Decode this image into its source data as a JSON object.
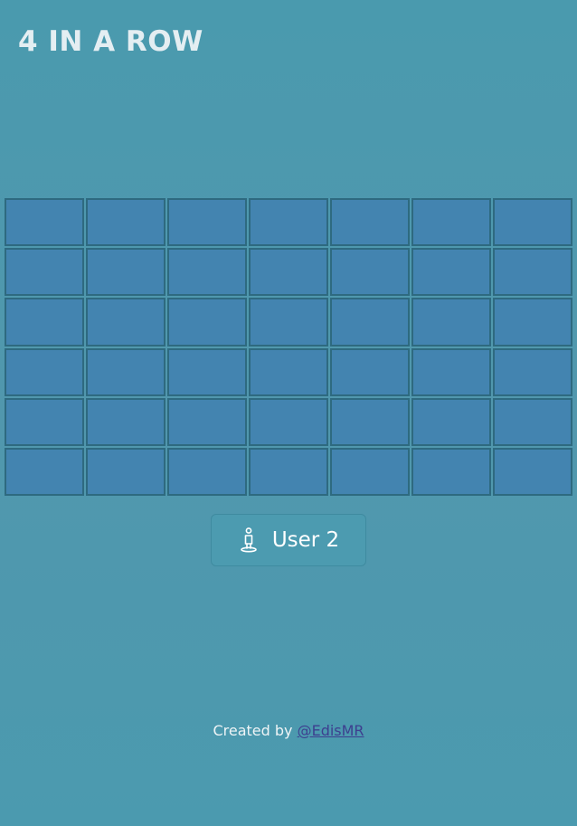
{
  "header": {
    "title": "4 IN A ROW"
  },
  "board": {
    "columns": 7,
    "rows": 6,
    "cells": [
      [
        "empty",
        "empty",
        "empty",
        "empty",
        "empty",
        "empty",
        "empty"
      ],
      [
        "empty",
        "empty",
        "empty",
        "empty",
        "empty",
        "empty",
        "empty"
      ],
      [
        "empty",
        "empty",
        "empty",
        "empty",
        "empty",
        "empty",
        "empty"
      ],
      [
        "empty",
        "empty",
        "empty",
        "empty",
        "empty",
        "empty",
        "empty"
      ],
      [
        "empty",
        "empty",
        "empty",
        "empty",
        "empty",
        "empty",
        "empty"
      ],
      [
        "empty",
        "empty",
        "empty",
        "empty",
        "empty",
        "empty",
        "empty"
      ]
    ],
    "cell_color": "#4384b0",
    "border_color": "#2e6a80"
  },
  "turn_indicator": {
    "icon": "user-icon",
    "label": "User 2"
  },
  "footer": {
    "prefix": "Created by",
    "link_text": "@EdisMR"
  },
  "colors": {
    "background": "#4b9aaf",
    "title": "#e4eef2",
    "link": "#3d3f8f"
  }
}
